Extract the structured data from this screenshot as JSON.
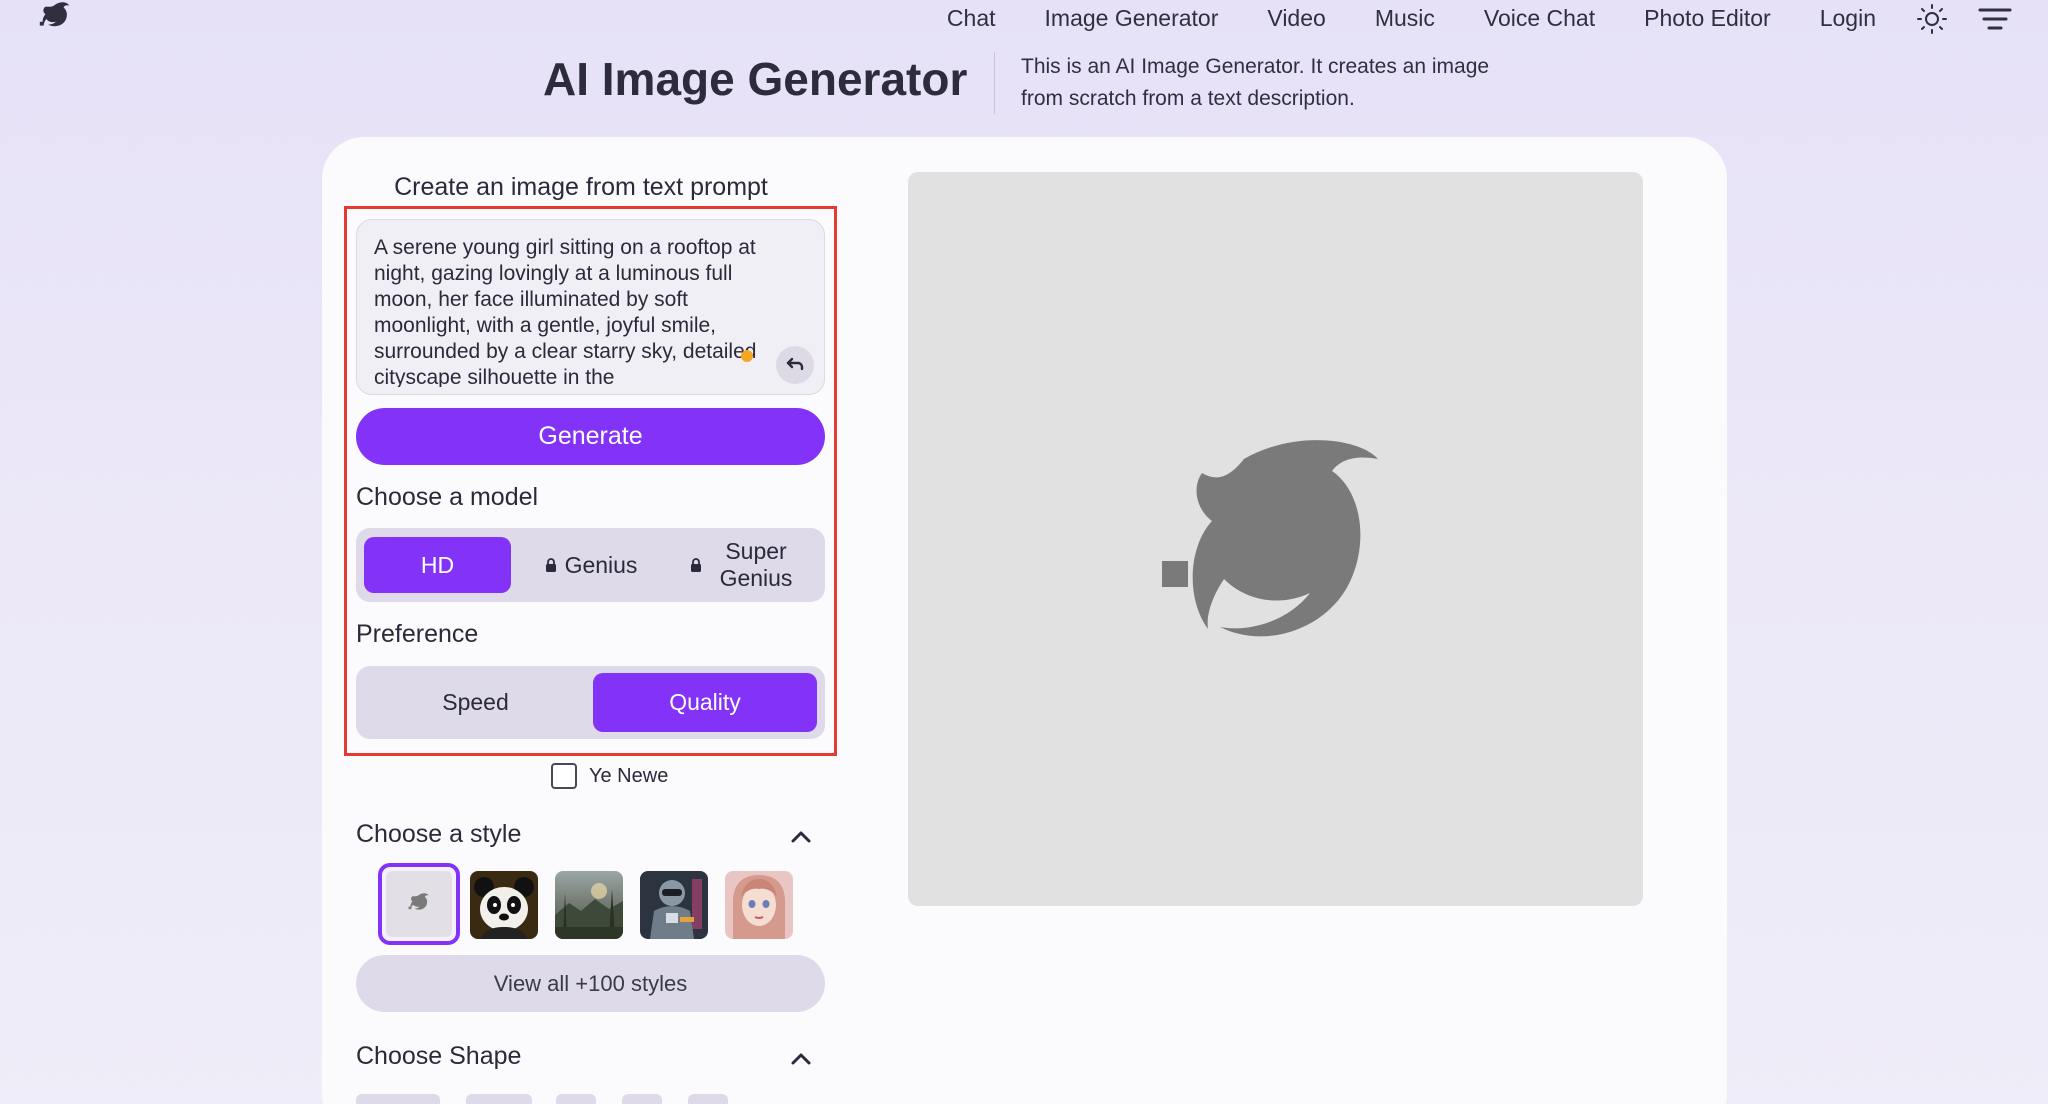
{
  "nav": {
    "links": [
      "Chat",
      "Image Generator",
      "Video",
      "Music",
      "Voice Chat",
      "Photo Editor",
      "Login"
    ]
  },
  "header": {
    "title": "AI Image Generator",
    "description": "This is an AI Image Generator. It creates an image from scratch from a text description."
  },
  "form": {
    "heading": "Create an image from text prompt",
    "prompt_value": "A serene young girl sitting on a rooftop at night, gazing lovingly at a luminous full moon, her face illuminated by soft moonlight, with a gentle, joyful smile, surrounded by a clear starry sky, detailed cityscape silhouette in the",
    "generate_label": "Generate",
    "model_label": "Choose a model",
    "models": {
      "hd": "HD",
      "genius": "Genius",
      "super_genius": "Super Genius",
      "selected": "HD"
    },
    "preference_label": "Preference",
    "preferences": {
      "speed": "Speed",
      "quality": "Quality",
      "selected": "Quality"
    },
    "checkbox_label": "Ye Newe",
    "checkbox_checked": false,
    "style_label": "Choose a style",
    "styles": [
      "default",
      "panda",
      "landscape",
      "robot",
      "anime-portrait"
    ],
    "selected_style": "default",
    "view_all_label": "View all +100 styles",
    "shape_label": "Choose Shape"
  },
  "colors": {
    "accent": "#8333f7",
    "highlight_border": "#e53a32",
    "dot": "#f5a623",
    "preview_bg": "#e1e1e1",
    "preview_logo": "#7a7a7a"
  }
}
